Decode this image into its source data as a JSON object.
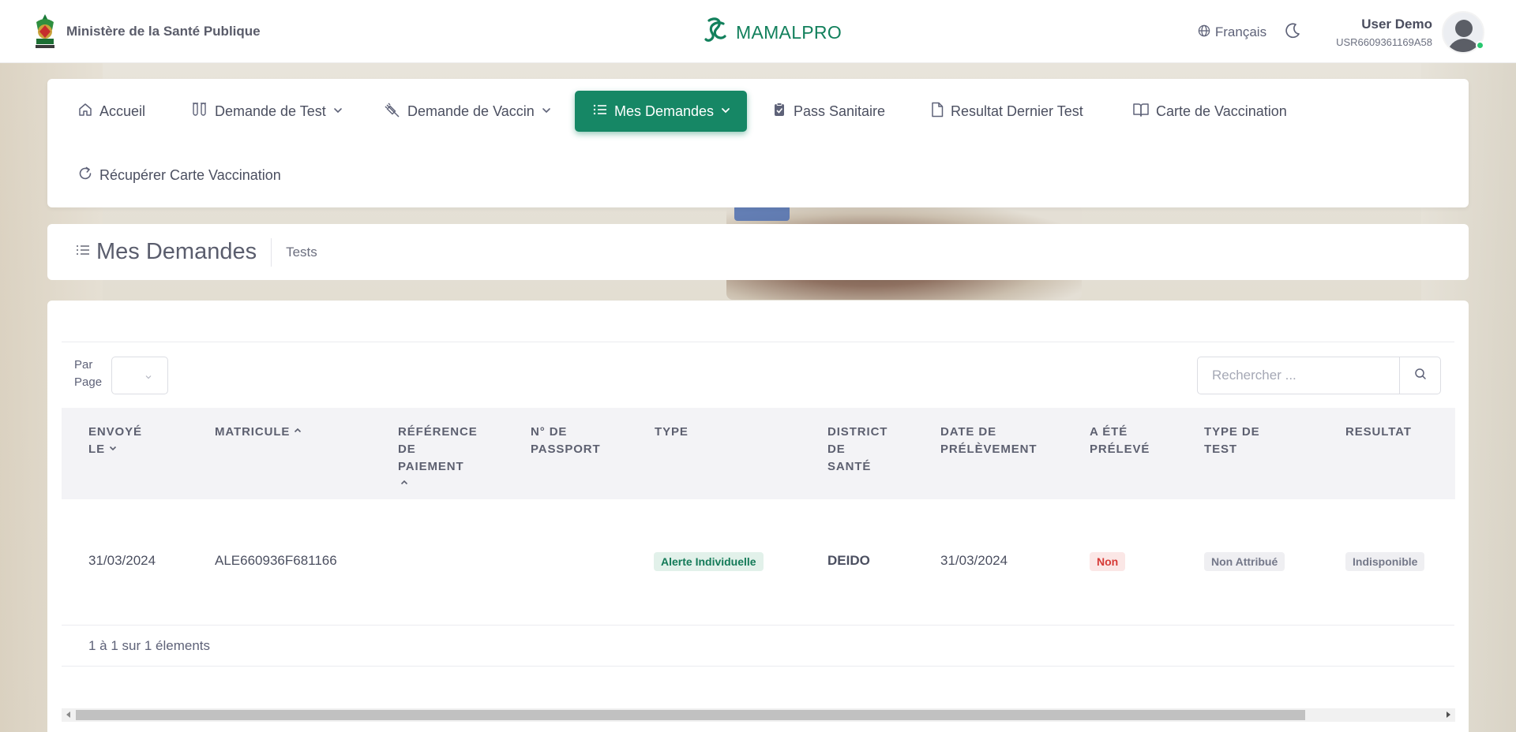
{
  "header": {
    "ministry": "Ministère de la Santé Publique",
    "brand": "MAMALPRO",
    "language": "Français",
    "user_name": "User Demo",
    "user_id": "USR6609361169A58"
  },
  "nav": {
    "home": "Accueil",
    "test_request": "Demande de Test",
    "vaccine_request": "Demande de Vaccin",
    "my_requests": "Mes Demandes",
    "health_pass": "Pass Sanitaire",
    "last_test": "Resultat Dernier Test",
    "vaccination_card": "Carte de Vaccination",
    "recover_card": "Récupérer Carte Vaccination"
  },
  "page": {
    "title": "Mes Demandes",
    "breadcrumb": "Tests"
  },
  "table": {
    "per_page_label_1": "Par",
    "per_page_label_2": "Page",
    "search_placeholder": "Rechercher ...",
    "columns": {
      "sent": [
        "ENVOYÉ",
        "LE"
      ],
      "matricule": "MATRICULE",
      "payment_ref": [
        "RÉFÉRENCE",
        "DE",
        "PAIEMENT"
      ],
      "passport": [
        "N° DE",
        "PASSPORT"
      ],
      "type": "TYPE",
      "district": [
        "DISTRICT",
        "DE",
        "SANTÉ"
      ],
      "sample_date": [
        "DATE DE",
        "PRÉLÈVEMENT"
      ],
      "sampled": [
        "A ÉTÉ",
        "PRÉLEVÉ"
      ],
      "test_type": [
        "TYPE DE",
        "TEST"
      ],
      "result": "RESULTAT"
    },
    "rows": [
      {
        "sent": "31/03/2024",
        "matricule": "ALE660936F681166",
        "type": "Alerte Individuelle",
        "district": "DEIDO",
        "sample_date": "31/03/2024",
        "sampled": "Non",
        "test_type": "Non Attribué",
        "result": "Indisponible"
      }
    ],
    "count_text": "1 à 1 sur 1 élements"
  },
  "colors": {
    "brand_green": "#168765",
    "online": "#28c76f",
    "danger": "#d63a36"
  }
}
